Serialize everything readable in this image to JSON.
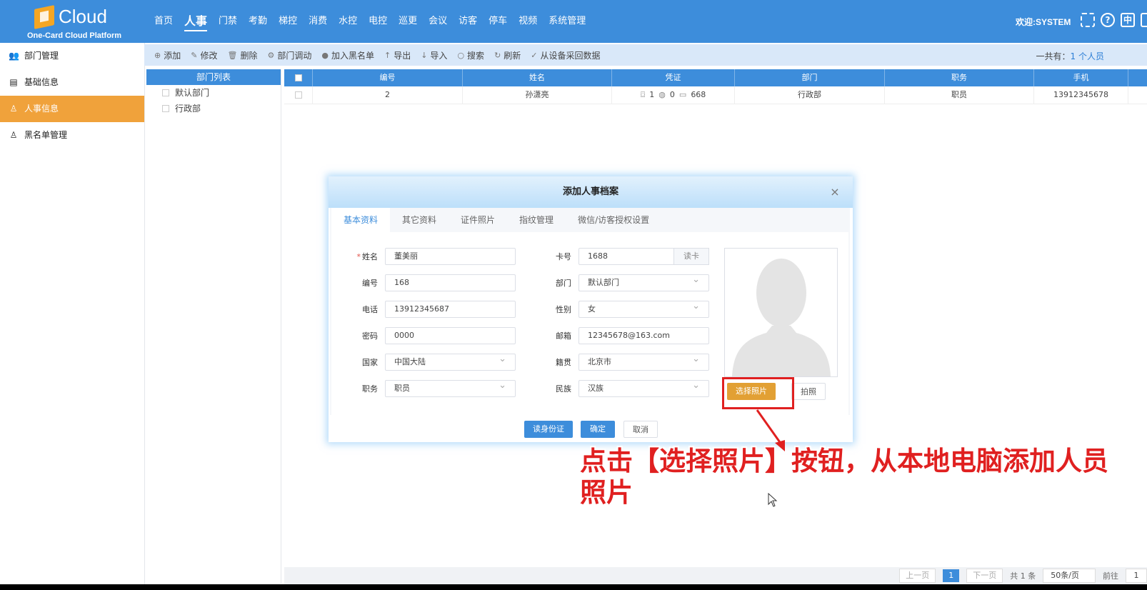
{
  "header": {
    "logo_text": "Cloud",
    "logo_sub": "One-Card Cloud Platform",
    "nav": [
      "首页",
      "人事",
      "门禁",
      "考勤",
      "梯控",
      "消费",
      "水控",
      "电控",
      "巡更",
      "会议",
      "访客",
      "停车",
      "视频",
      "系统管理"
    ],
    "active_nav": "人事",
    "welcome": "欢迎:SYSTEM",
    "icon_help": "?",
    "icon_lang": "中"
  },
  "sidebar": {
    "items": [
      {
        "label": "部门管理",
        "icon": "users-icon"
      },
      {
        "label": "基础信息",
        "icon": "document-icon"
      },
      {
        "label": "人事信息",
        "icon": "user-icon"
      },
      {
        "label": "黑名单管理",
        "icon": "user-block-icon"
      }
    ],
    "active": "人事信息"
  },
  "toolbar": {
    "items": [
      {
        "label": "添加",
        "icon": "⊕"
      },
      {
        "label": "修改",
        "icon": "✎"
      },
      {
        "label": "删除",
        "icon": "🗑"
      },
      {
        "label": "部门调动",
        "icon": "⚙"
      },
      {
        "label": "加入黑名单",
        "icon": "●"
      },
      {
        "label": "导出",
        "icon": "↑"
      },
      {
        "label": "导入",
        "icon": "↓"
      },
      {
        "label": "搜索",
        "icon": "○"
      },
      {
        "label": "刷新",
        "icon": "↻"
      },
      {
        "label": "从设备采回数据",
        "icon": "✓"
      }
    ],
    "count_prefix": "一共有：",
    "count_value": "1 个人员"
  },
  "dept": {
    "header": "部门列表",
    "items": [
      "默认部门",
      "行政部"
    ]
  },
  "grid": {
    "columns": [
      "编号",
      "姓名",
      "凭证",
      "部门",
      "职务",
      "手机"
    ],
    "rows": [
      {
        "id": "2",
        "name": "孙潇亮",
        "cred_face": "1",
        "cred_finger": "0",
        "cred_card": "668",
        "dept": "行政部",
        "title": "职员",
        "phone": "13912345678"
      }
    ]
  },
  "pager": {
    "prev": "上一页",
    "current": "1",
    "next": "下一页",
    "total": "共 1 条",
    "page_size": "50条/页",
    "goto_label": "前往",
    "goto_value": "1"
  },
  "modal": {
    "title": "添加人事档案",
    "close": "×",
    "tabs": [
      "基本资料",
      "其它资料",
      "证件照片",
      "指纹管理",
      "微信/访客授权设置"
    ],
    "active_tab": "基本资料",
    "left_fields": [
      {
        "label": "姓名",
        "value": "董美丽",
        "required": "*"
      },
      {
        "label": "编号",
        "value": "168"
      },
      {
        "label": "电话",
        "value": "13912345687"
      },
      {
        "label": "密码",
        "value": "0000"
      },
      {
        "label": "国家",
        "value": "中国大陆"
      },
      {
        "label": "职务",
        "value": "职员"
      }
    ],
    "right_fields": [
      {
        "label": "卡号",
        "value": "1688"
      },
      {
        "label": "部门",
        "value": "默认部门"
      },
      {
        "label": "性别",
        "value": "女"
      },
      {
        "label": "邮箱",
        "value": "12345678@163.com"
      },
      {
        "label": "籍贯",
        "value": "北京市"
      },
      {
        "label": "民族",
        "value": "汉族"
      }
    ],
    "read_card": "读卡",
    "select_photo": "选择照片",
    "take_photo": "拍照",
    "read_id": "读身份证",
    "ok": "确定",
    "cancel": "取消"
  },
  "annotation": {
    "text": "点击【选择照片】按钮，从本地电脑添加人员照片",
    "color": "#e02020"
  },
  "colors": {
    "primary": "#3d8ddb",
    "accent": "#f0a23b",
    "toolbar_bg": "#d9e8f9"
  }
}
